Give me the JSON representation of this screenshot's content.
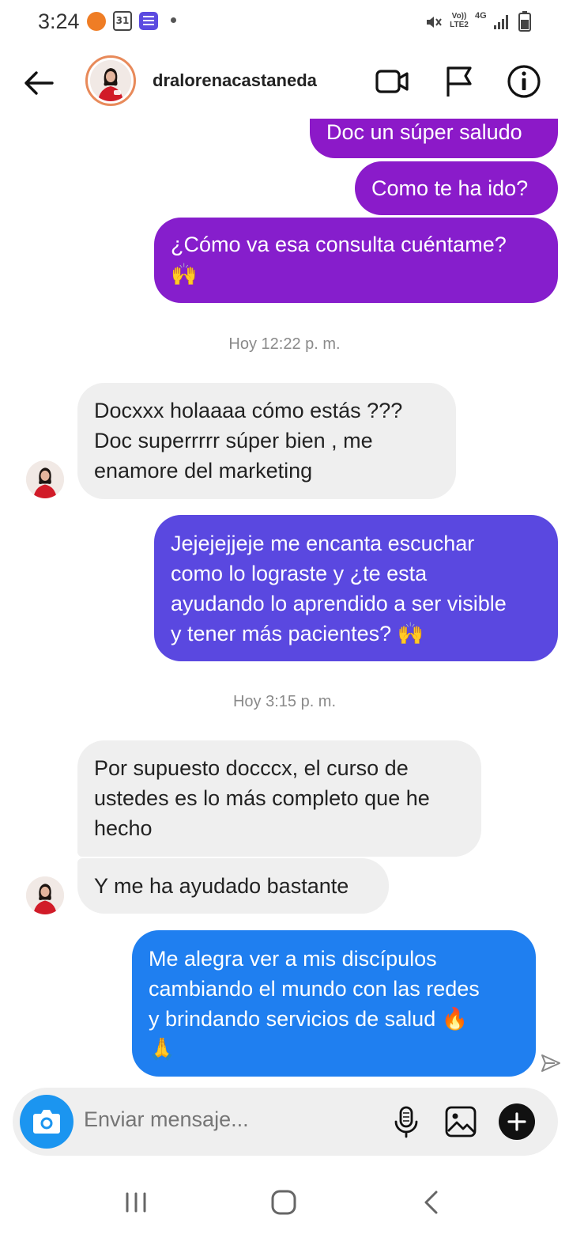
{
  "status_bar": {
    "time": "3:24",
    "calendar_day": "31",
    "volte_label": "Vo)) LTE2",
    "network": "4G"
  },
  "header": {
    "username": "dralorenacastaneda",
    "icons": [
      "back-arrow-icon",
      "video-call-icon",
      "flag-icon",
      "info-icon"
    ]
  },
  "messages": [
    {
      "type": "outgoing",
      "lines": [
        "Doc un súper saludo"
      ]
    },
    {
      "type": "outgoing",
      "lines": [
        "Como te ha ido?"
      ]
    },
    {
      "type": "outgoing",
      "lines": [
        "¿Cómo va esa consulta cuéntame?",
        "🙌"
      ]
    },
    {
      "type": "timestamp",
      "text": "Hoy 12:22 p. m."
    },
    {
      "type": "incoming",
      "lines": [
        "Docxxx holaaaa cómo estás ???",
        "Doc superrrrr súper bien , me",
        "enamore del marketing"
      ]
    },
    {
      "type": "outgoing",
      "lines": [
        "Jejejejjeje me encanta escuchar",
        "como lo lograste y ¿te esta",
        "ayudando lo aprendido a ser visible",
        "y tener más pacientes? 🙌"
      ]
    },
    {
      "type": "timestamp",
      "text": "Hoy 3:15 p. m."
    },
    {
      "type": "incoming",
      "lines": [
        "Por supuesto docccx, el curso de",
        "ustedes es lo más completo que he",
        "hecho"
      ]
    },
    {
      "type": "incoming",
      "lines": [
        "Y me ha ayudado bastante"
      ]
    },
    {
      "type": "outgoing",
      "lines": [
        "Me alegra ver a mis discípulos",
        "cambiando el mundo con las redes",
        "y brindando servicios de salud 🔥",
        "🙏"
      ]
    }
  ],
  "composer": {
    "placeholder": "Enviar mensaje...",
    "icons": [
      "camera-icon",
      "microphone-icon",
      "gallery-icon",
      "plus-icon"
    ]
  },
  "navbar": {
    "icons": [
      "recent-apps-icon",
      "home-icon",
      "back-icon"
    ]
  },
  "colors": {
    "outgoing_purple": "#8c19c8",
    "outgoing_indigo": "#5a48e0",
    "outgoing_blue": "#1f7ff0",
    "incoming_bg": "#efefef",
    "camera_blue": "#1b95f0"
  }
}
